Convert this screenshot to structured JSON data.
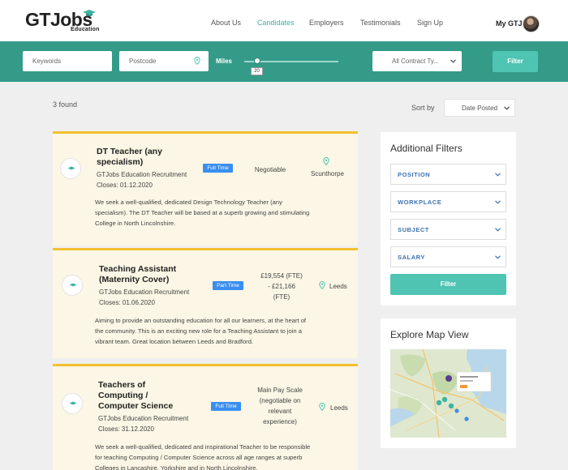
{
  "brand": {
    "logo_main": "GTJobs",
    "logo_sub": "Education"
  },
  "nav": [
    {
      "label": "About Us",
      "active": false
    },
    {
      "label": "Candidates",
      "active": true
    },
    {
      "label": "Employers",
      "active": false
    },
    {
      "label": "Testimonials",
      "active": false
    },
    {
      "label": "Sign Up",
      "active": false
    }
  ],
  "account": {
    "label": "My GTJ"
  },
  "search": {
    "keywords_placeholder": "Keywords",
    "postcode_placeholder": "Postcode",
    "miles_label": "Miles",
    "miles_value": "20",
    "contract_selected": "All Contract Ty...",
    "filter_label": "Filter"
  },
  "results": {
    "count_text": "3 found",
    "sort_label": "Sort by",
    "sort_selected": "Date Posted"
  },
  "jobs": [
    {
      "title_lines": [
        "DT Teacher (any",
        "specialism)"
      ],
      "company": "GTJobs Education Recruitment",
      "closes": "Closes: 01.12.2020",
      "type": "Full Time",
      "salary_lines": [
        "Negotiable"
      ],
      "location": "Scunthorpe",
      "desc_lines": [
        "We seek a well-qualified, dedicated Design Technology Teacher (any",
        "specialism). The DT Teacher will be based at a superb growing and stimulating",
        "College in North Lincolnshire."
      ]
    },
    {
      "title_lines": [
        "Teaching Assistant",
        "(Maternity Cover)"
      ],
      "company": "GTJobs Education Recruitment",
      "closes": "Closes: 01.06.2020",
      "type": "Part Time",
      "salary_lines": [
        "£19,554 (FTE)",
        "- £21,166",
        "(FTE)"
      ],
      "location": "Leeds",
      "desc_lines": [
        "Aiming to provide an outstanding education for all our learners, at the heart of",
        "the community. This is an exciting new role for a Teaching Assistant to join a",
        "vibrant team. Great location between Leeds and Bradford."
      ]
    },
    {
      "title_lines": [
        "Teachers of",
        "Computing /",
        "Computer Science"
      ],
      "company": "GTJobs Education Recruitment",
      "closes": "Closes: 31.12.2020",
      "type": "Full Time",
      "salary_lines": [
        "Main Pay Scale",
        "(negotiable on",
        "relevant",
        "experience)"
      ],
      "location": "Leeds",
      "desc_lines": [
        "We seek a well-qualified, dedicated and inspirational Teacher to be responsible",
        "for teaching Computing / Computer Science across all age ranges at superb",
        "Colleges in Lancashire, Yorkshire and in North Lincolnshire."
      ]
    }
  ],
  "filters": {
    "title": "Additional Filters",
    "items": [
      "POSITION",
      "WORKPLACE",
      "SUBJECT",
      "SALARY"
    ],
    "button_label": "Filter"
  },
  "map": {
    "title": "Explore Map View"
  },
  "colors": {
    "teal": "#349b89",
    "accent": "#4fc4b3",
    "card_border": "#f2c12e",
    "card_bg": "#fbf6e5",
    "badge": "#3a8ef0"
  }
}
